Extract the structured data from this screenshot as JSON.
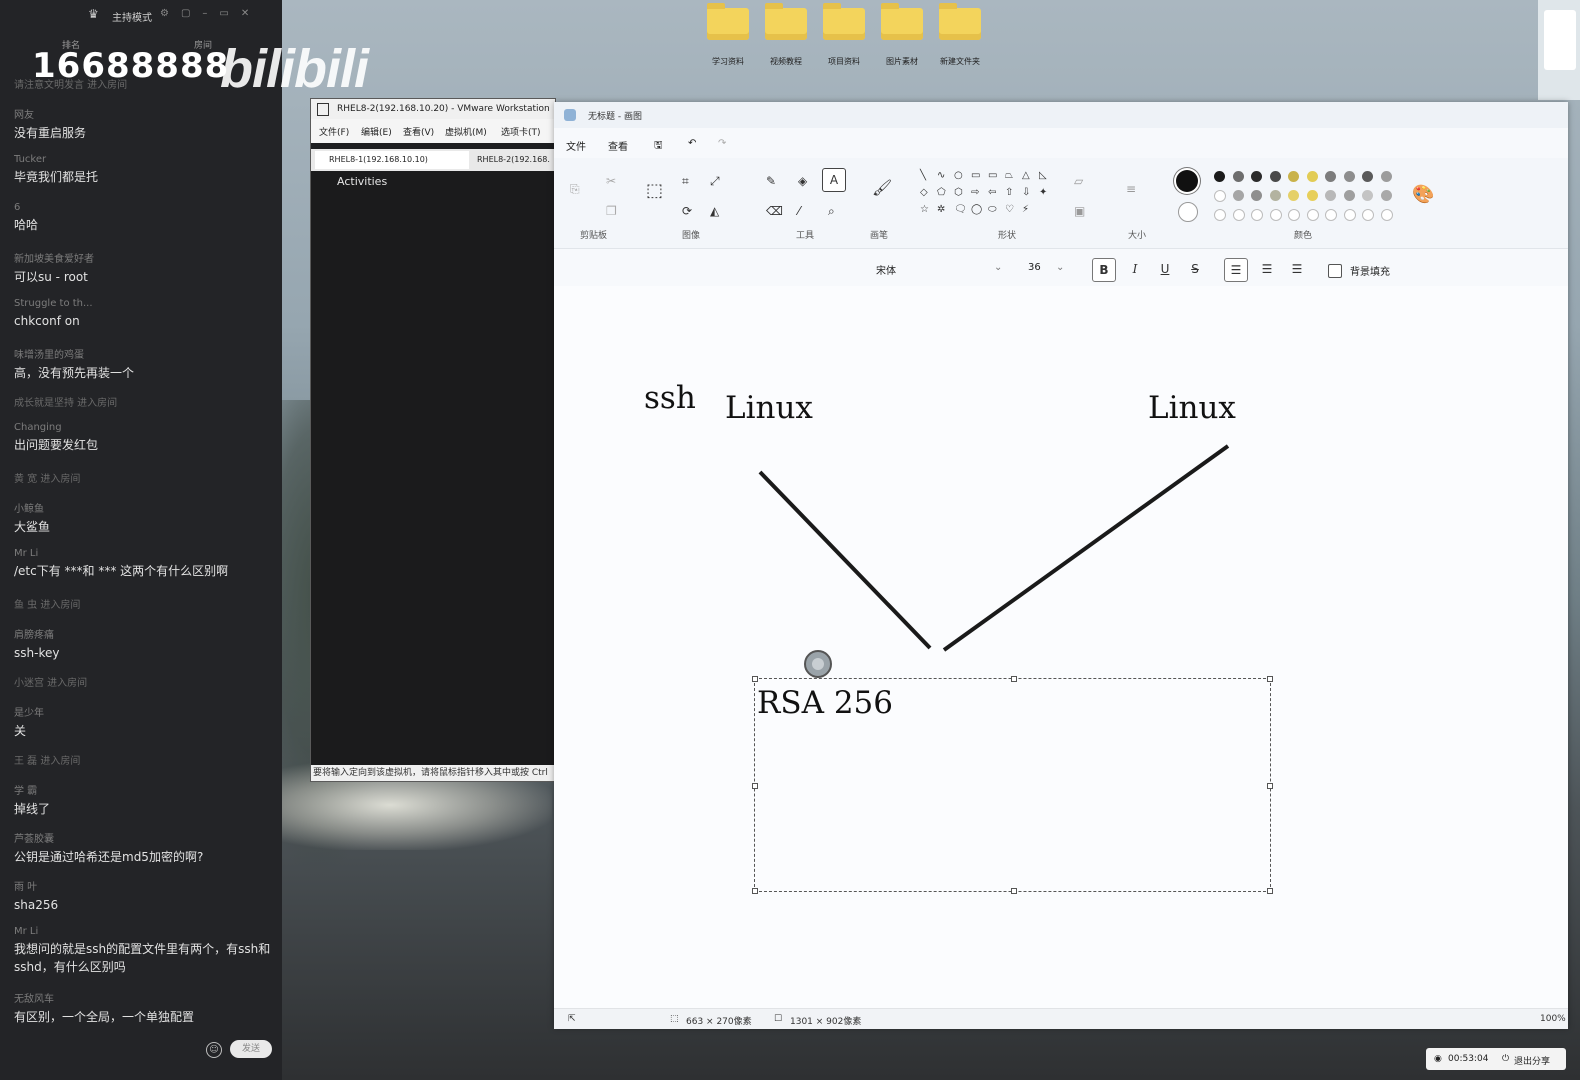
{
  "chat": {
    "mode_label": "主持模式",
    "header_left": "排名",
    "header_right": "房间",
    "room_number": "16688888",
    "logo_text": "bilibili",
    "messages": [
      {
        "user": "",
        "text": "",
        "join": "请注意文明发言 进入房间"
      },
      {
        "user": "网友",
        "text": "没有重启服务"
      },
      {
        "user": "Tucker",
        "text": "毕竟我们都是托"
      },
      {
        "user": "6",
        "text": "哈哈"
      },
      {
        "user": "新加坡美食爱好者",
        "text": "可以su - root"
      },
      {
        "user": "Struggle to th...",
        "text": "chkconf on"
      },
      {
        "user": "味增汤里的鸡蛋",
        "text": "高，没有预先再装一个"
      },
      {
        "user": "",
        "text": "",
        "join": "成长就是坚持 进入房间"
      },
      {
        "user": "Changing",
        "text": "出问题要发红包"
      },
      {
        "user": "",
        "text": "",
        "join": "黄 宽 进入房间"
      },
      {
        "user": "小鲸鱼",
        "text": "大鲨鱼"
      },
      {
        "user": "Mr Li",
        "text": "/etc下有 ***和 *** 这两个有什么区别啊"
      },
      {
        "user": "",
        "text": "",
        "join": "鱼 虫 进入房间"
      },
      {
        "user": "肩膀疼痛",
        "text": "ssh-key"
      },
      {
        "user": "",
        "text": "",
        "join": "小迷宫 进入房间"
      },
      {
        "user": "是少年",
        "text": "关"
      },
      {
        "user": "",
        "text": "",
        "join": "王 磊 进入房间"
      },
      {
        "user": "学 霸",
        "text": "掉线了"
      },
      {
        "user": "芦荟胶囊",
        "text": "公钥是通过哈希还是md5加密的啊?"
      },
      {
        "user": "雨 叶",
        "text": "sha256"
      },
      {
        "user": "Mr Li",
        "text": "我想问的就是ssh的配置文件里有两个，有ssh和sshd，有什么区别吗"
      },
      {
        "user": "无敌风车",
        "text": "有区别，一个全局，一个单独配置"
      }
    ],
    "send_label": "发送"
  },
  "desktop": {
    "icons": [
      "学习资料",
      "视频教程",
      "项目资料",
      "图片素材",
      "新建文件夹"
    ]
  },
  "vmware": {
    "title": "RHEL8-2(192.168.10.20) - VMware Workstation",
    "menu": [
      "文件(F)",
      "编辑(E)",
      "查看(V)",
      "虚拟机(M)",
      "选项卡(T)"
    ],
    "tabs": [
      "RHEL8-1(192.168.10.10)",
      "RHEL8-2(192.168."
    ],
    "activities": "Activities",
    "status": "要将输入定向到该虚拟机，请将鼠标指针移入其中或按 Ctrl"
  },
  "paint": {
    "title": "无标题 - 画图",
    "menu": [
      "文件",
      "查看"
    ],
    "groups": [
      "剪贴板",
      "图像",
      "工具",
      "画笔",
      "形状",
      "大小",
      "颜色"
    ],
    "font_name": "宋体",
    "font_size": "36",
    "bg_fill_label": "背景填充",
    "canvas_texts": {
      "ssh": "ssh",
      "linux_left": "Linux",
      "linux_right": "Linux",
      "rsa": "RSA 256"
    },
    "status": {
      "selection_size": "663 × 270像素",
      "canvas_size": "1301 × 902像素",
      "zoom": "100%"
    },
    "palette_row1": [
      "#1b1b1b",
      "#6d6d6d",
      "#2b2b2b",
      "#4a4a4a",
      "#c9b24a",
      "#e2cc55",
      "#7c7c7c",
      "#8d8d8d",
      "#5a5a5a",
      "#9c9c9c"
    ],
    "palette_row2": [
      "hollow",
      "#a6a6a6",
      "#8f8f8f",
      "#b3b3a0",
      "#e5d068",
      "#e7cf5a",
      "#b8b8b8",
      "#9f9f9f",
      "#c4c4c4",
      "#a9a9a9"
    ]
  },
  "share": {
    "timer": "00:53:04",
    "exit_label": "退出分享"
  }
}
